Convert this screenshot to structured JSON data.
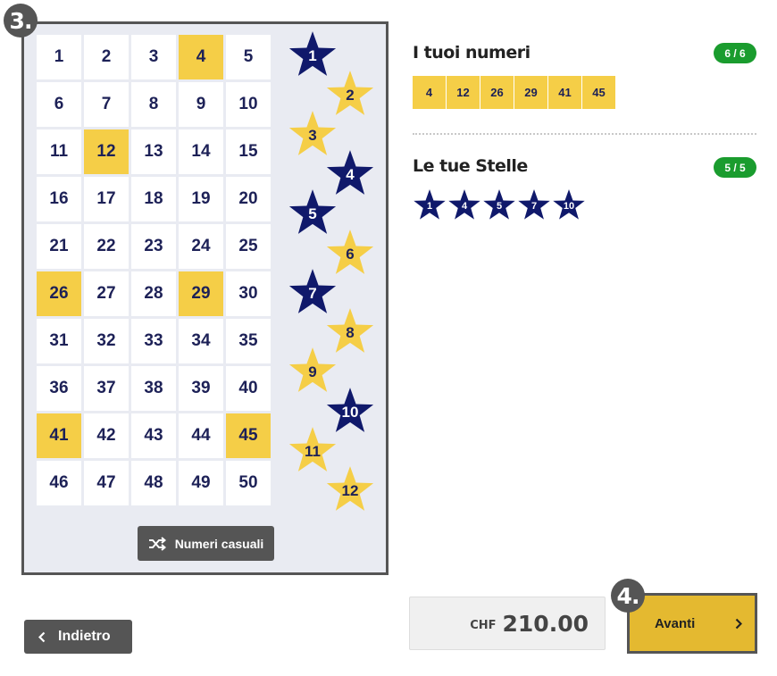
{
  "steps": {
    "board_step": "3.",
    "next_step": "4."
  },
  "board": {
    "numbers": [
      1,
      2,
      3,
      4,
      5,
      6,
      7,
      8,
      9,
      10,
      11,
      12,
      13,
      14,
      15,
      16,
      17,
      18,
      19,
      20,
      21,
      22,
      23,
      24,
      25,
      26,
      27,
      28,
      29,
      30,
      31,
      32,
      33,
      34,
      35,
      36,
      37,
      38,
      39,
      40,
      41,
      42,
      43,
      44,
      45,
      46,
      47,
      48,
      49,
      50
    ],
    "selected_numbers": [
      4,
      12,
      26,
      29,
      41,
      45
    ],
    "stars": [
      1,
      2,
      3,
      4,
      5,
      6,
      7,
      8,
      9,
      10,
      11,
      12
    ],
    "selected_stars": [
      1,
      4,
      5,
      7,
      10
    ],
    "random_button_label": "Numeri casuali",
    "random_icon": "shuffle-icon"
  },
  "summary": {
    "numbers_title": "I tuoi numeri",
    "numbers_count": "6 / 6",
    "chosen_numbers": [
      "4",
      "12",
      "26",
      "29",
      "41",
      "45"
    ],
    "stars_title": "Le tue Stelle",
    "stars_count": "5 / 5",
    "chosen_stars": [
      "1",
      "4",
      "5",
      "7",
      "10"
    ]
  },
  "footer": {
    "back_label": "Indietro",
    "currency": "CHF",
    "price": "210.00",
    "next_label": "Avanti"
  },
  "colors": {
    "selected_yellow": "#f5ce47",
    "star_navy": "#10196b",
    "board_bg": "#e9ebf2",
    "count_green": "#1a9c2e",
    "dark_gray": "#555555"
  }
}
